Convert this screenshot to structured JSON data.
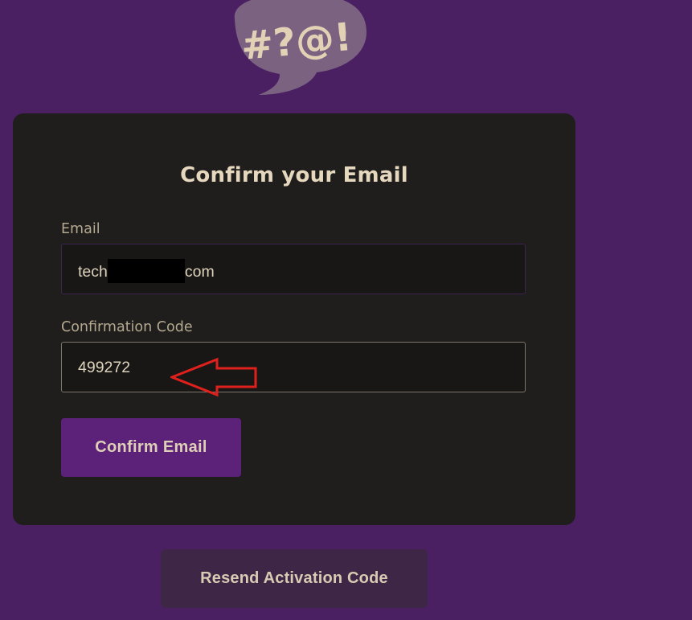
{
  "logo": {
    "icon": "speech-bubble-symbols-icon",
    "text": "#?@!",
    "bubble_color": "#7a6280",
    "text_color": "#e3d1b6"
  },
  "form": {
    "title": "Confirm your Email",
    "email": {
      "label": "Email",
      "value_prefix": "tech",
      "value_suffix": "com",
      "redacted": true
    },
    "code": {
      "label": "Confirmation Code",
      "value": "499272"
    },
    "confirm_button": "Confirm Email"
  },
  "resend_button": "Resend Activation Code",
  "annotation": {
    "icon": "left-arrow-icon",
    "color": "#e0201c"
  },
  "colors": {
    "background": "#4a2063",
    "card": "#201e1c",
    "accent": "#5c2179",
    "text": "#e6d8bf"
  }
}
